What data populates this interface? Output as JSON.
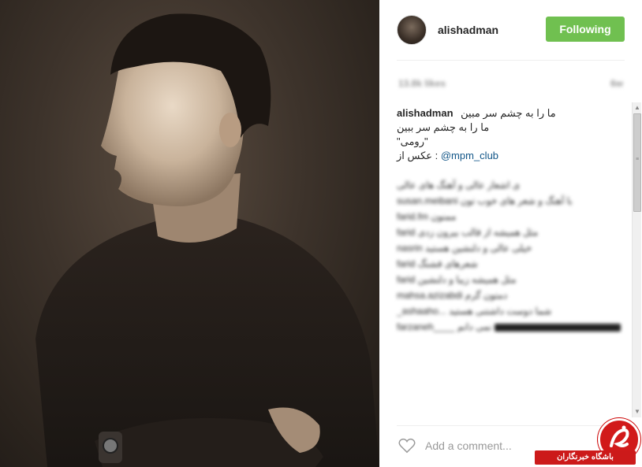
{
  "post": {
    "username": "alishadman",
    "follow_label": "Following",
    "meta_likes": "13.8k likes",
    "meta_time": "6w",
    "caption_user": "alishadman",
    "caption_lines": [
      "ما را به چشم سر مبین",
      "ما را به چشم سر ببین",
      "\"رومی\"",
      "عکس از : "
    ],
    "caption_mention": "@mpm_club",
    "comment_placeholder": "Add a comment..."
  },
  "comments": [
    "ی اشعار عالی و آهنگ های عالی",
    "susan.meibani با آهنگ و شعر های خوب تون",
    "farid.fm ممنون",
    "farid مثل همیشه از قالب بیرون زدی",
    "nasrin خیلی عالی و دلنشین هستید",
    "farid شعرهای قشنگ",
    "farid مثل همیشه زیبا و دلنشین",
    "mahsa.azizabdi دمتون گرم",
    "_ashaaho... شما دوست داشتنی هستید",
    "farzaneh____ نمی دانم"
  ],
  "watermark": {
    "label": "باشگاه خبرنگاران"
  },
  "colors": {
    "follow_green": "#70c050",
    "mention_blue": "#125688",
    "watermark_red": "#cc1a1a"
  },
  "icons": {
    "heart": "heart-outline-icon",
    "scroll_up": "arrow-up-icon",
    "scroll_down": "arrow-down-icon"
  }
}
